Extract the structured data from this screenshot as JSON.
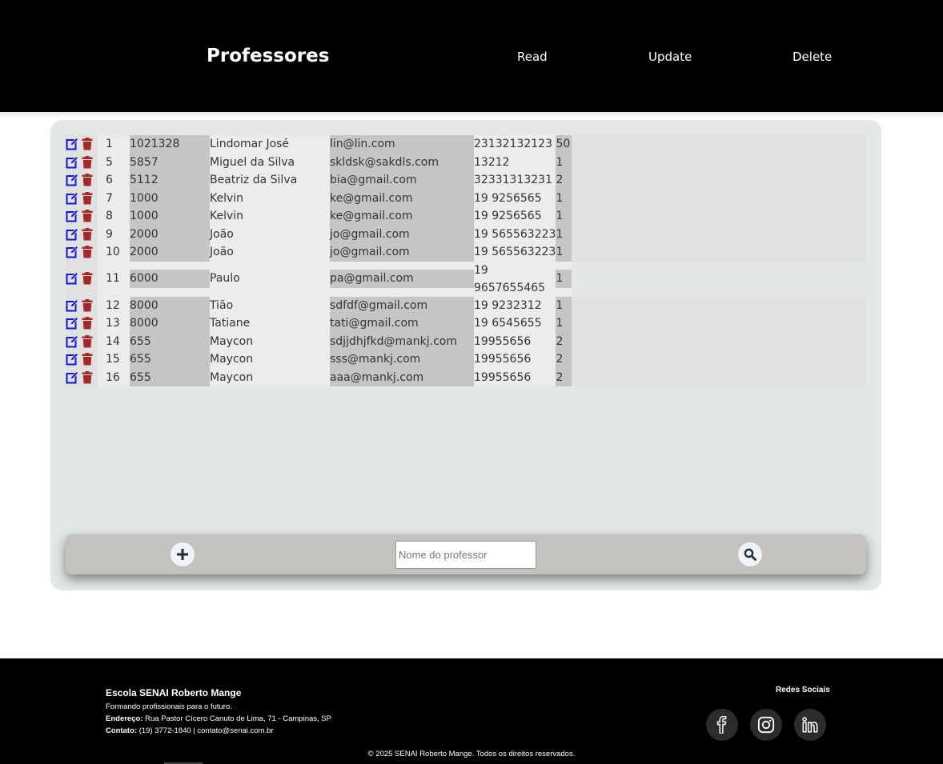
{
  "header": {
    "title": "Professores",
    "nav": {
      "read": "Read",
      "update": "Update",
      "delete": "Delete"
    }
  },
  "rows": [
    {
      "id": "1",
      "codigo": "1021328",
      "nome": "Lindomar José",
      "email": "lin@lin.com",
      "telefone": "23132132123",
      "n": "50"
    },
    {
      "id": "5",
      "codigo": "5857",
      "nome": "Miguel da Silva",
      "email": "skldsk@sakdls.com",
      "telefone": "13212",
      "n": "1"
    },
    {
      "id": "6",
      "codigo": "5112",
      "nome": "Beatriz da Silva",
      "email": "bia@gmail.com",
      "telefone": "32331313231",
      "n": "2"
    },
    {
      "id": "7",
      "codigo": "1000",
      "nome": "Kelvin",
      "email": "ke@gmail.com",
      "telefone": "19 9256565",
      "n": "1"
    },
    {
      "id": "8",
      "codigo": "1000",
      "nome": "Kelvin",
      "email": "ke@gmail.com",
      "telefone": "19 9256565",
      "n": "1"
    },
    {
      "id": "9",
      "codigo": "2000",
      "nome": "João",
      "email": "jo@gmail.com",
      "telefone": "19 565563223",
      "n": "1"
    },
    {
      "id": "10",
      "codigo": "2000",
      "nome": "João",
      "email": "jo@gmail.com",
      "telefone": "19 565563223",
      "n": "1"
    },
    {
      "id": "11",
      "codigo": "6000",
      "nome": "Paulo",
      "email": "pa@gmail.com",
      "telefone": "19 9657655465",
      "n": "1"
    },
    {
      "id": "12",
      "codigo": "8000",
      "nome": "Tião",
      "email": "sdfdf@gmail.com",
      "telefone": "19 9232312",
      "n": "1"
    },
    {
      "id": "13",
      "codigo": "8000",
      "nome": "Tatiane",
      "email": "tati@gmail.com",
      "telefone": "19 6545655",
      "n": "1"
    },
    {
      "id": "14",
      "codigo": "655",
      "nome": "Maycon",
      "email": "sdjjdhjfkd@mankj.com",
      "telefone": "19955656",
      "n": "2"
    },
    {
      "id": "15",
      "codigo": "655",
      "nome": "Maycon",
      "email": "sss@mankj.com",
      "telefone": "19955656",
      "n": "2"
    },
    {
      "id": "16",
      "codigo": "655",
      "nome": "Maycon",
      "email": "aaa@mankj.com",
      "telefone": "19955656",
      "n": "2"
    }
  ],
  "toolbar": {
    "search_placeholder": "Nome do professor",
    "add_icon": "plus-icon",
    "search_icon": "search-icon"
  },
  "colors": {
    "edit_icon": "#1515d8",
    "trash_icon": "#a52828",
    "header_bg": "#000000",
    "panel_bg": "#e1e8e6",
    "toolbar_bg": "#c4c2bf"
  },
  "footer": {
    "school": "Escola SENAI Roberto Mange",
    "tagline": "Formando profissionais para o futuro.",
    "address_label": "Endereço:",
    "address": "Rua Pastor Cícero Canuto de Lima, 71 - Campinas, SP",
    "contact_label": "Contato:",
    "contact": "(19) 3772-1840 | contato@senai.com.br",
    "social_title": "Redes Sociais",
    "social": [
      "facebook-icon",
      "instagram-icon",
      "linkedin-icon"
    ],
    "copyright": "© 2025 SENAI Roberto Mange. Todos os direitos reservados."
  }
}
